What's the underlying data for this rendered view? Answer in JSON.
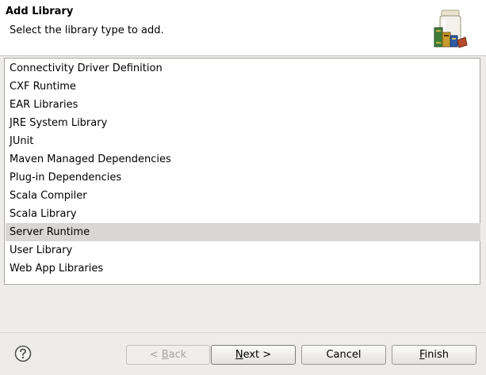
{
  "dialog": {
    "title": "Add Library",
    "subtitle": "Select the library type to add."
  },
  "library_types": [
    {
      "label": "Connectivity Driver Definition",
      "selected": false
    },
    {
      "label": "CXF Runtime",
      "selected": false
    },
    {
      "label": "EAR Libraries",
      "selected": false
    },
    {
      "label": "JRE System Library",
      "selected": false
    },
    {
      "label": "JUnit",
      "selected": false
    },
    {
      "label": "Maven Managed Dependencies",
      "selected": false
    },
    {
      "label": "Plug-in Dependencies",
      "selected": false
    },
    {
      "label": "Scala Compiler",
      "selected": false
    },
    {
      "label": "Scala Library",
      "selected": false
    },
    {
      "label": "Server Runtime",
      "selected": true
    },
    {
      "label": "User Library",
      "selected": false
    },
    {
      "label": "Web App Libraries",
      "selected": false
    }
  ],
  "buttons": {
    "back": {
      "prefix": "< ",
      "mnemonic": "B",
      "rest": "ack",
      "enabled": false
    },
    "next": {
      "prefix": "",
      "mnemonic": "N",
      "rest": "ext >",
      "enabled": true
    },
    "cancel": {
      "label": "Cancel",
      "enabled": true
    },
    "finish": {
      "prefix": "",
      "mnemonic": "F",
      "rest": "inish",
      "enabled": true
    }
  },
  "icons": {
    "header": "library-jar-books-icon",
    "help": "help-question-icon"
  },
  "colors": {
    "header_bg": "#ffffff",
    "dialog_bg": "#edeceb",
    "selection_bg": "#d8d7d3"
  }
}
